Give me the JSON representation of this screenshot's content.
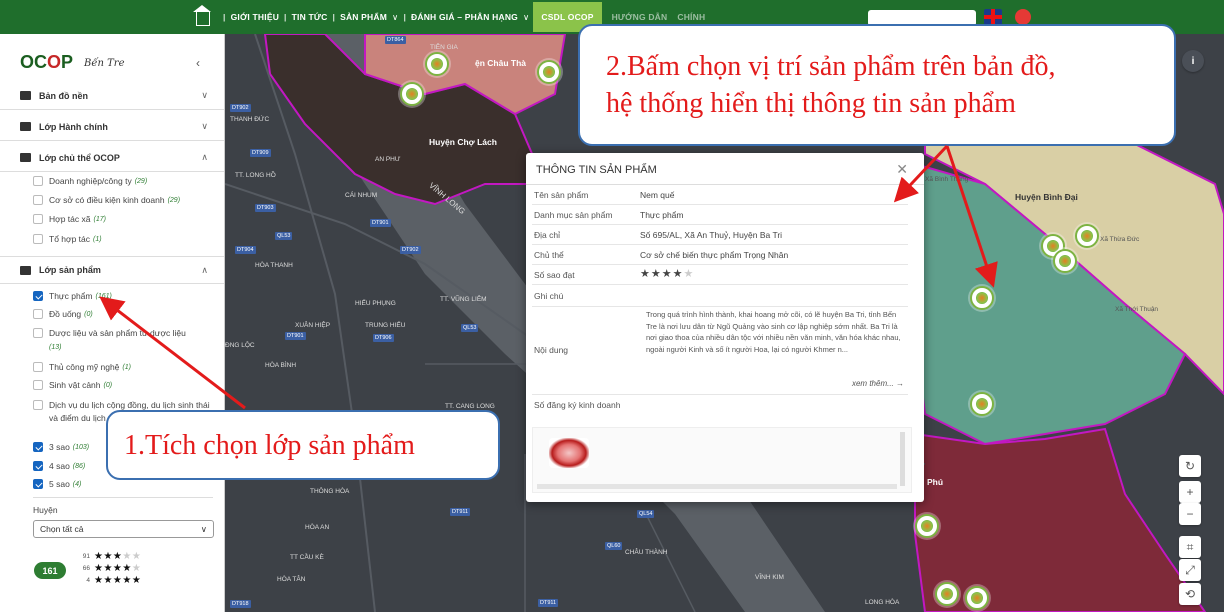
{
  "nav": {
    "items": [
      {
        "label": "GIỚI THIỆU",
        "dropdown": false
      },
      {
        "label": "TIN TỨC",
        "dropdown": false
      },
      {
        "label": "SẢN PHẨM",
        "dropdown": true
      },
      {
        "label": "ĐÁNH GIÁ – PHÂN HẠNG",
        "dropdown": true
      }
    ],
    "active": "CSDL OCOP",
    "faded": [
      "HƯỚNG DẪN",
      "CHÍNH"
    ]
  },
  "sidebar": {
    "logo": "OCOP",
    "logo_sub": "Bến Tre",
    "sections": {
      "basemap": "Bản đồ nền",
      "admin": "Lớp Hành chính",
      "entity": "Lớp chủ thể OCOP",
      "product": "Lớp sản phẩm"
    },
    "entity_items": [
      {
        "label": "Doanh nghiệp/công ty",
        "count": "(29)",
        "checked": false
      },
      {
        "label": "Cơ sở có điều kiện kinh doanh",
        "count": "(29)",
        "checked": false
      },
      {
        "label": "Hợp tác xã",
        "count": "(17)",
        "checked": false
      },
      {
        "label": "Tổ hợp tác",
        "count": "(1)",
        "checked": false
      }
    ],
    "product_items": [
      {
        "label": "Thực phẩm",
        "count": "(161)",
        "checked": true
      },
      {
        "label": "Đồ uống",
        "count": "(0)",
        "checked": false
      },
      {
        "label": "Dược liệu và sản phẩm từ dược liệu",
        "count": "(13)",
        "checked": false
      },
      {
        "label": "Thủ công mỹ nghệ",
        "count": "(1)",
        "checked": false
      },
      {
        "label": "Sinh vật cảnh",
        "count": "(0)",
        "checked": false
      },
      {
        "label": "Dịch vụ du lịch cộng đồng, du lịch sinh thái và điểm du lịch",
        "count": "",
        "checked": false
      }
    ],
    "star_items": [
      {
        "label": "3 sao",
        "count": "(103)",
        "checked": true
      },
      {
        "label": "4 sao",
        "count": "(86)",
        "checked": true
      },
      {
        "label": "5 sao",
        "count": "(4)",
        "checked": true
      }
    ],
    "district_label": "Huyện",
    "district_value": "Chọn tất cả",
    "total": "161",
    "star_summary": [
      {
        "count": "91",
        "stars": 3
      },
      {
        "count": "66",
        "stars": 4
      },
      {
        "count": "4",
        "stars": 5
      }
    ]
  },
  "popup": {
    "title": "THÔNG TIN SẢN PHẨM",
    "rows": [
      {
        "key": "Tên sản phẩm",
        "value": "Nem quế"
      },
      {
        "key": "Danh mục sản phẩm",
        "value": "Thực phẩm"
      },
      {
        "key": "Địa chỉ",
        "value": "Số 695/AL, Xã An Thuỷ, Huyện Ba Tri"
      },
      {
        "key": "Chủ thể",
        "value": "Cơ sở chế biến thực phẩm Trọng Nhân"
      }
    ],
    "stars_label": "Số sao đạt",
    "stars": 4,
    "note_label": "Ghi chú",
    "content_label": "Nội dung",
    "content": "Trong quá trình hình thành, khai hoang mở cõi, có lẽ huyện Ba Tri, tỉnh Bến Tre là nơi lưu dân từ Ngũ Quảng vào sinh cơ lập nghiệp sớm nhất. Ba Tri là nơi giao thoa của nhiều dân tộc với nhiều nền văn minh, văn hóa khác nhau, ngoài người Kinh và số ít người Hoa, lại có người Khmer n...",
    "more": "xem thêm... →",
    "reg_label": "Số đăng ký kinh doanh"
  },
  "map": {
    "labels": [
      {
        "text": "Huyện Chợ Lách",
        "cls": "big"
      },
      {
        "text": "Huyện Bình Đại",
        "cls": "big"
      },
      {
        "text": "ện Châu Thà",
        "cls": "big"
      },
      {
        "text": "TIÊN GIA",
        "cls": ""
      },
      {
        "text": "THANH ĐỨC",
        "cls": ""
      },
      {
        "text": "AN PHƯ",
        "cls": ""
      },
      {
        "text": "TT. LONG HỒ",
        "cls": ""
      },
      {
        "text": "CÁI NHUM",
        "cls": ""
      },
      {
        "text": "VĨNH LONG",
        "cls": ""
      },
      {
        "text": "HÒA THANH",
        "cls": ""
      },
      {
        "text": "HIẾU PHỤNG",
        "cls": ""
      },
      {
        "text": "TT. VŨNG LIÊM",
        "cls": ""
      },
      {
        "text": "XUÂN HIỆP",
        "cls": ""
      },
      {
        "text": "TRUNG HIẾU",
        "cls": ""
      },
      {
        "text": "HÒA BÌNH",
        "cls": ""
      },
      {
        "text": "ĐNG LỘC",
        "cls": ""
      },
      {
        "text": "TT. CANG LONG",
        "cls": ""
      },
      {
        "text": "THÔNG HÒA",
        "cls": ""
      },
      {
        "text": "HÒA AN",
        "cls": ""
      },
      {
        "text": "TT CẦU KÈ",
        "cls": ""
      },
      {
        "text": "HÒA TÂN",
        "cls": ""
      },
      {
        "text": "CHÂU THÀNH",
        "cls": ""
      },
      {
        "text": "VĨNH KIM",
        "cls": ""
      },
      {
        "text": "LONG HÒA",
        "cls": ""
      },
      {
        "text": "Xã Bình Thắng",
        "cls": "dark"
      },
      {
        "text": "Xã Thới Thuận",
        "cls": ""
      },
      {
        "text": "Xã Thừa Đức",
        "cls": ""
      },
      {
        "text": "Phú",
        "cls": "big"
      }
    ],
    "roads": [
      "DT864",
      "DT902",
      "DT909",
      "DT903",
      "DT901",
      "QL53",
      "DT904",
      "DT902",
      "DT901",
      "DT906",
      "QL53",
      "DT911",
      "QL54",
      "QL60",
      "DT911",
      "DT918"
    ]
  },
  "callouts": {
    "one": "1.Tích chọn lớp sản phẩm",
    "two_line1": "2.Bấm chọn vị trí sản phẩm trên bản đồ,",
    "two_line2": "hệ thống hiển thị thông tin sản phẩm"
  },
  "colors": {
    "nav_bg": "#1f6e2c",
    "nav_active": "#8bc34a",
    "accent_green": "#2e7d32",
    "checkbox_blue": "#1565c0",
    "callout_text": "#e31b1b",
    "callout_border": "#3b6fb0",
    "district_border": "#c218c2"
  }
}
